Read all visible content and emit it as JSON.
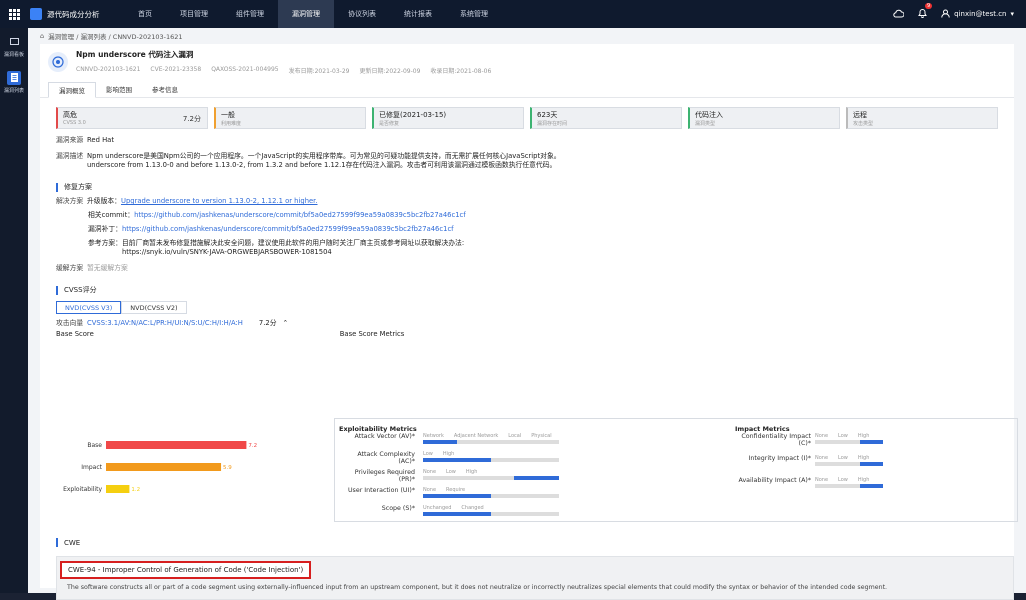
{
  "topbar": {
    "app_name": "源代码成分分析",
    "nav": [
      "首页",
      "项目管理",
      "组件管理",
      "漏洞管理",
      "协议列表",
      "统计报表",
      "系统管理"
    ],
    "active_nav_index": 3,
    "notification_count": "9",
    "user": "qinxin@test.cn"
  },
  "sidebar": {
    "items": [
      {
        "label": "漏洞看板",
        "icon": "dashboard-icon"
      },
      {
        "label": "漏洞列表",
        "icon": "list-icon"
      }
    ]
  },
  "breadcrumb": "漏洞管理 / 漏洞列表 / CNNVD-202103-1621",
  "vuln": {
    "title": "Npm underscore 代码注入漏洞",
    "meta": [
      "CNNVD-202103-1621",
      "CVE-2021-23358",
      "QAXOSS-2021-004995",
      "发布日期:2021-03-29",
      "更新日期:2022-09-09",
      "收录日期:2021-08-06"
    ]
  },
  "tabs": [
    "漏洞概览",
    "影响范围",
    "参考信息"
  ],
  "cards": [
    {
      "value": "高危",
      "label": "CVSS 3.0",
      "right": "7.2分",
      "color": "#e24a4a"
    },
    {
      "value": "一般",
      "label": "利用难度",
      "right": "",
      "color": "#f0a030"
    },
    {
      "value": "已修复(2021-03-15)",
      "label": "是否修复",
      "right": "",
      "color": "#3cb371"
    },
    {
      "value": "623天",
      "label": "漏洞存在时间",
      "right": "",
      "color": "#3cb371"
    },
    {
      "value": "代码注入",
      "label": "漏洞类型",
      "right": "",
      "color": "#3cb371"
    },
    {
      "value": "远程",
      "label": "攻击类型",
      "right": "",
      "color": "#bbbbbb"
    }
  ],
  "source": {
    "key": "漏洞来源",
    "value": "Red Hat"
  },
  "desc": {
    "key": "漏洞描述",
    "line1": "Npm underscore是美国Npm公司的一个应用程序。一个JavaScript的实用程序带库。可为常见的可疑功能提供支持，而无需扩展任何核心JavaScript对象。",
    "line2": "underscore from 1.13.0-0 and before 1.13.0-2, from 1.3.2 and before 1.12.1存在代码注入漏洞。攻击者可利用该漏洞通过模板函数执行任意代码。"
  },
  "fix": {
    "title": "修复方案",
    "solution_key": "解决方案",
    "upgrade_label": "升级版本：",
    "upgrade_link": "Upgrade underscore to version 1.13.0-2, 1.12.1 or higher.",
    "commit_label": "相关commit：",
    "commit_link": "https://github.com/jashkenas/underscore/commit/bf5a0ed27599f99ea59a0839c5bc2fb27a46c1cf",
    "patch_label": "漏洞补丁：",
    "patch_link": "https://github.com/jashkenas/underscore/commit/bf5a0ed27599f99ea59a0839c5bc2fb27a46c1cf",
    "ref_label": "参考方案：",
    "ref_text": "目前厂商暂未发布修复措施解决此安全问题，建议使用此软件的用户随时关注厂商主页或参考网址以获取解决办法:",
    "ref_url": "https://snyk.io/vuln/SNYK-JAVA-ORGWEBJARSBOWER-1081504",
    "mitigation_key": "缓解方案",
    "mitigation_value": "暂无缓解方案"
  },
  "cvss": {
    "title": "CVSS评分",
    "tabs": [
      "NVD(CVSS V3)",
      "NVD(CVSS V2)"
    ],
    "vector_key": "攻击向量",
    "vector": "CVSS:3.1/AV:N/AC:L/PR:H/UI:N/S:U/C:H/I:H/A:H",
    "score": "7.2分",
    "base_score_title": "Base Score",
    "metrics_title": "Base Score Metrics",
    "exploitability_title": "Exploitability Metrics",
    "impact_title": "Impact Metrics"
  },
  "chart_data": {
    "type": "bar",
    "orientation": "horizontal",
    "categories": [
      "Base",
      "Impact",
      "Exploitability"
    ],
    "values": [
      7.2,
      5.9,
      1.2
    ],
    "colors": [
      "#f04848",
      "#f29a1c",
      "#f5cf10"
    ],
    "xlim": [
      0,
      10
    ]
  },
  "exploit_metrics": [
    {
      "label": "Attack Vector (AV)*",
      "options": [
        "Network",
        "Adjacent Network",
        "Local",
        "Physical"
      ],
      "selected": 0
    },
    {
      "label": "Attack Complexity (AC)*",
      "options": [
        "Low",
        "High"
      ],
      "selected": 0
    },
    {
      "label": "Privileges Required (PR)*",
      "options": [
        "None",
        "Low",
        "High"
      ],
      "selected": 2
    },
    {
      "label": "User Interaction (UI)*",
      "options": [
        "None",
        "Require"
      ],
      "selected": 0
    },
    {
      "label": "Scope (S)*",
      "options": [
        "Unchanged",
        "Changed"
      ],
      "selected": 0
    }
  ],
  "impact_metrics": [
    {
      "label": "Confidentiality Impact (C)*",
      "options": [
        "None",
        "Low",
        "High"
      ],
      "selected": 2
    },
    {
      "label": "Integrity Impact (I)*",
      "options": [
        "None",
        "Low",
        "High"
      ],
      "selected": 2
    },
    {
      "label": "Availability Impact (A)*",
      "options": [
        "None",
        "Low",
        "High"
      ],
      "selected": 2
    }
  ],
  "cwe": {
    "title": "CWE",
    "name": "CWE-94 - Improper Control of Generation of Code ('Code Injection')",
    "desc": "The software constructs all or part of a code segment using externally-influenced input from an upstream component, but it does not neutralize or incorrectly neutralizes special elements that could modify the syntax or behavior of the intended code segment."
  }
}
